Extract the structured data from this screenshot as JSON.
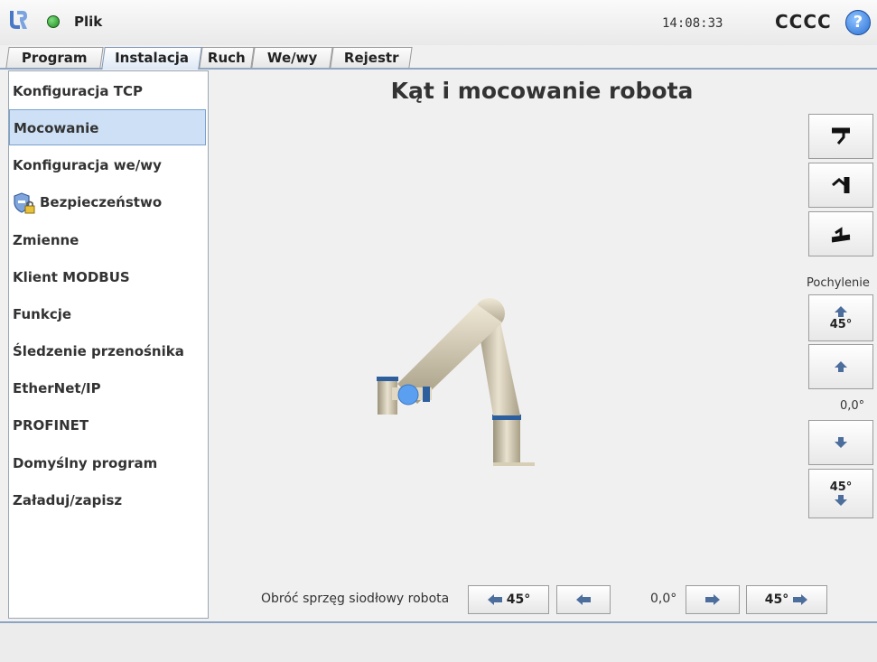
{
  "header": {
    "file_label": "Plik",
    "clock": "14:08:33",
    "robot_name": "CCCC",
    "help_glyph": "?",
    "status_color": "#2e9e2e",
    "accent": "#2a6fd4"
  },
  "tabs": [
    {
      "label": "Program"
    },
    {
      "label": "Instalacja"
    },
    {
      "label": "Ruch"
    },
    {
      "label": "We/wy"
    },
    {
      "label": "Rejestr"
    }
  ],
  "sidebar": {
    "items": [
      {
        "label": "Konfiguracja TCP"
      },
      {
        "label": "Mocowanie"
      },
      {
        "label": "Konfiguracja we/wy"
      },
      {
        "label": "Bezpieczeństwo"
      },
      {
        "label": "Zmienne"
      },
      {
        "label": "Klient MODBUS"
      },
      {
        "label": "Funkcje"
      },
      {
        "label": "Śledzenie przenośnika"
      },
      {
        "label": "EtherNet/IP"
      },
      {
        "label": "PROFINET"
      },
      {
        "label": "Domyślny program"
      },
      {
        "label": "Załaduj/zapisz"
      }
    ]
  },
  "main": {
    "title": "Kąt i mocowanie robota",
    "tilt": {
      "label": "Pochylenie",
      "step_label": "45°",
      "value": "0,0°"
    },
    "rotation": {
      "label": "Obróć sprzęg siodłowy robota",
      "step_label": "45°",
      "value": "0,0°"
    }
  }
}
